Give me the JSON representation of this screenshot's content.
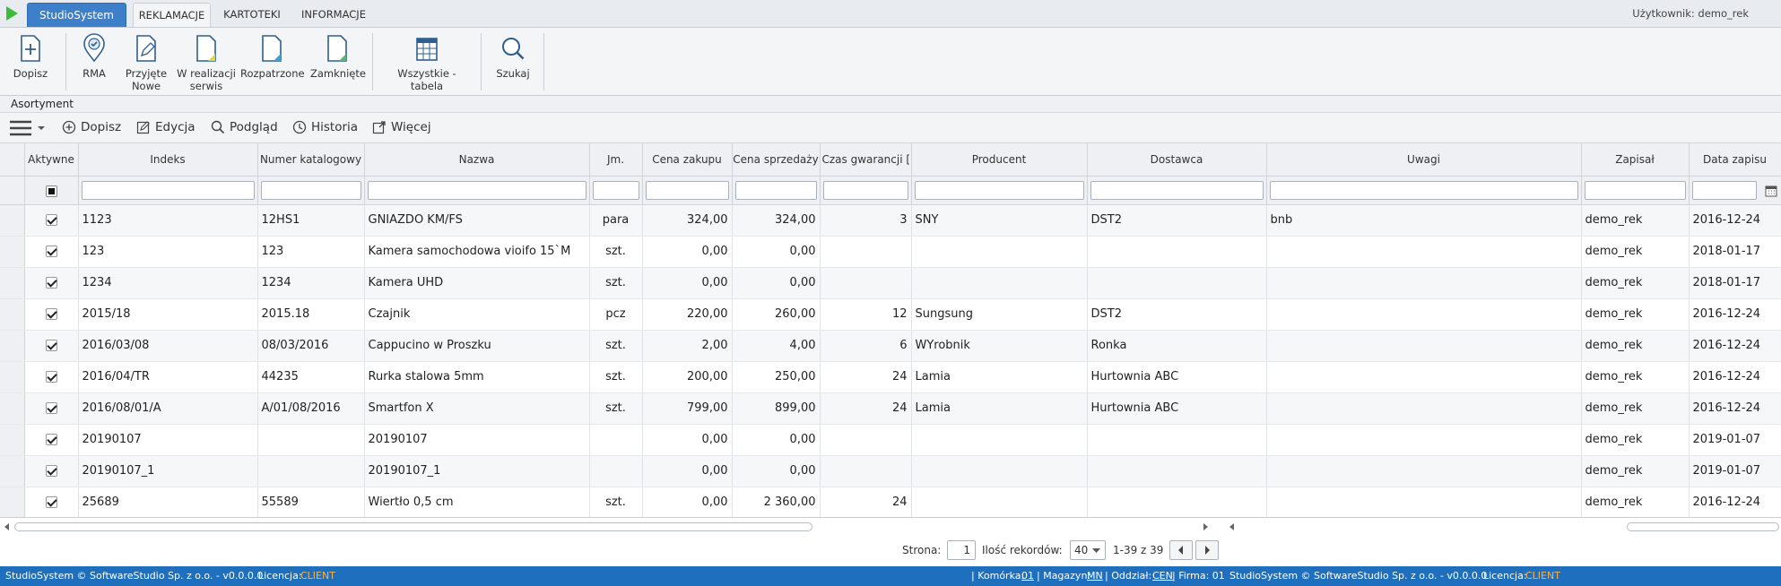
{
  "topbar": {
    "app_name": "StudioSystem",
    "tabs": [
      "REKLAMACJE",
      "KARTOTEKI",
      "INFORMACJE"
    ],
    "user_label": "Użytkownik: demo_rek"
  },
  "ribbon": {
    "buttons": [
      {
        "label": "Dopisz",
        "icon": "new-document-plus-icon"
      },
      {
        "label": "RMA",
        "icon": "location-check-icon"
      },
      {
        "label": "Przyjęte",
        "label2": "Nowe",
        "icon": "document-pencil-icon"
      },
      {
        "label": "W realizacji",
        "label2": "serwis",
        "icon": "document-yellow-corner-icon"
      },
      {
        "label": "Rozpatrzone",
        "icon": "document-blue-corner-icon"
      },
      {
        "label": "Zamknięte",
        "icon": "document-green-corner-icon"
      },
      {
        "label": "Wszystkie - tabela",
        "icon": "table-grid-icon"
      },
      {
        "label": "Szukaj",
        "icon": "magnifier-icon"
      }
    ]
  },
  "section_title": "Asortyment",
  "toolbar": {
    "add": "Dopisz",
    "edit": "Edycja",
    "preview": "Podgląd",
    "history": "Historia",
    "more": "Więcej"
  },
  "grid": {
    "columns": [
      "Aktywne",
      "Indeks",
      "Numer katalogowy",
      "Nazwa",
      "Jm.",
      "Cena zakupu",
      "Cena sprzedaży",
      "Czas gwarancji [m",
      "Producent",
      "Dostawca",
      "Uwagi",
      "Zapisał",
      "Data zapisu"
    ],
    "rows": [
      {
        "indeks": "1123",
        "katalog": "12HS1",
        "nazwa": "GNIAZDO KM/FS",
        "jm": "para",
        "zakup": "324,00",
        "sprzedaz": "324,00",
        "gwarancja": "3",
        "producent": "SNY",
        "dostawca": "DST2",
        "uwagi": "bnb",
        "zapisal": "demo_rek",
        "data": "2016-12-24"
      },
      {
        "indeks": "123",
        "katalog": "123",
        "nazwa": "Kamera samochodowa vioifo 15`M",
        "jm": "szt.",
        "zakup": "0,00",
        "sprzedaz": "0,00",
        "gwarancja": "",
        "producent": "",
        "dostawca": "",
        "uwagi": "",
        "zapisal": "demo_rek",
        "data": "2018-01-17"
      },
      {
        "indeks": "1234",
        "katalog": "1234",
        "nazwa": "Kamera UHD",
        "jm": "szt.",
        "zakup": "0,00",
        "sprzedaz": "0,00",
        "gwarancja": "",
        "producent": "",
        "dostawca": "",
        "uwagi": "",
        "zapisal": "demo_rek",
        "data": "2018-01-17"
      },
      {
        "indeks": "2015/18",
        "katalog": "2015.18",
        "nazwa": "Czajnik",
        "jm": "pcz",
        "zakup": "220,00",
        "sprzedaz": "260,00",
        "gwarancja": "12",
        "producent": "Sungsung",
        "dostawca": "DST2",
        "uwagi": "",
        "zapisal": "demo_rek",
        "data": "2016-12-24"
      },
      {
        "indeks": "2016/03/08",
        "katalog": "08/03/2016",
        "nazwa": "Cappucino w Proszku",
        "jm": "szt.",
        "zakup": "2,00",
        "sprzedaz": "4,00",
        "gwarancja": "6",
        "producent": "WYrobnik",
        "dostawca": "Ronka",
        "uwagi": "",
        "zapisal": "demo_rek",
        "data": "2016-12-24"
      },
      {
        "indeks": "2016/04/TR",
        "katalog": "44235",
        "nazwa": "Rurka stalowa 5mm",
        "jm": "szt.",
        "zakup": "200,00",
        "sprzedaz": "250,00",
        "gwarancja": "24",
        "producent": "Lamia",
        "dostawca": "Hurtownia ABC",
        "uwagi": "",
        "zapisal": "demo_rek",
        "data": "2016-12-24"
      },
      {
        "indeks": "2016/08/01/A",
        "katalog": "A/01/08/2016",
        "nazwa": "Smartfon X",
        "jm": "szt.",
        "zakup": "799,00",
        "sprzedaz": "899,00",
        "gwarancja": "24",
        "producent": "Lamia",
        "dostawca": "Hurtownia ABC",
        "uwagi": "",
        "zapisal": "demo_rek",
        "data": "2016-12-24"
      },
      {
        "indeks": "20190107",
        "katalog": "",
        "nazwa": "20190107",
        "jm": "",
        "zakup": "0,00",
        "sprzedaz": "0,00",
        "gwarancja": "",
        "producent": "",
        "dostawca": "",
        "uwagi": "",
        "zapisal": "demo_rek",
        "data": "2019-01-07"
      },
      {
        "indeks": "20190107_1",
        "katalog": "",
        "nazwa": "20190107_1",
        "jm": "",
        "zakup": "0,00",
        "sprzedaz": "0,00",
        "gwarancja": "",
        "producent": "",
        "dostawca": "",
        "uwagi": "",
        "zapisal": "demo_rek",
        "data": "2019-01-07"
      },
      {
        "indeks": "25689",
        "katalog": "55589",
        "nazwa": "Wiertło 0,5 cm",
        "jm": "szt.",
        "zakup": "0,00",
        "sprzedaz": "2 360,00",
        "gwarancja": "24",
        "producent": "",
        "dostawca": "",
        "uwagi": "",
        "zapisal": "demo_rek",
        "data": "2016-12-24"
      }
    ]
  },
  "pager": {
    "page_label": "Strona:",
    "page_value": "1",
    "count_label": "Ilość rekordów:",
    "count_value": "40",
    "range": "1-39 z 39"
  },
  "statusbar": {
    "left_copy": "StudioSystem © SoftwareStudio Sp. z o.o. - v0.0.0.0",
    "license_label": "Licencja:",
    "license_value": "CLIENT",
    "komorka_label": "| Komórka:",
    "komorka_value": "01",
    "magazyn_label": "| Magazyn:",
    "magazyn_value": "MN",
    "oddzial_label": "| Oddział:",
    "oddzial_value": "CEN",
    "firma_label": "| Firma: 01",
    "right_copy": "StudioSystem © SoftwareStudio Sp. z o.o. - v0.0.0.0",
    "license_label2": "Licencja:",
    "license_value2": "CLIENT"
  },
  "colors": {
    "brand_blue": "#3d7fc9",
    "status_blue": "#1f6fbf",
    "license_orange": "#ffb347",
    "play_green": "#3dbb3d"
  }
}
